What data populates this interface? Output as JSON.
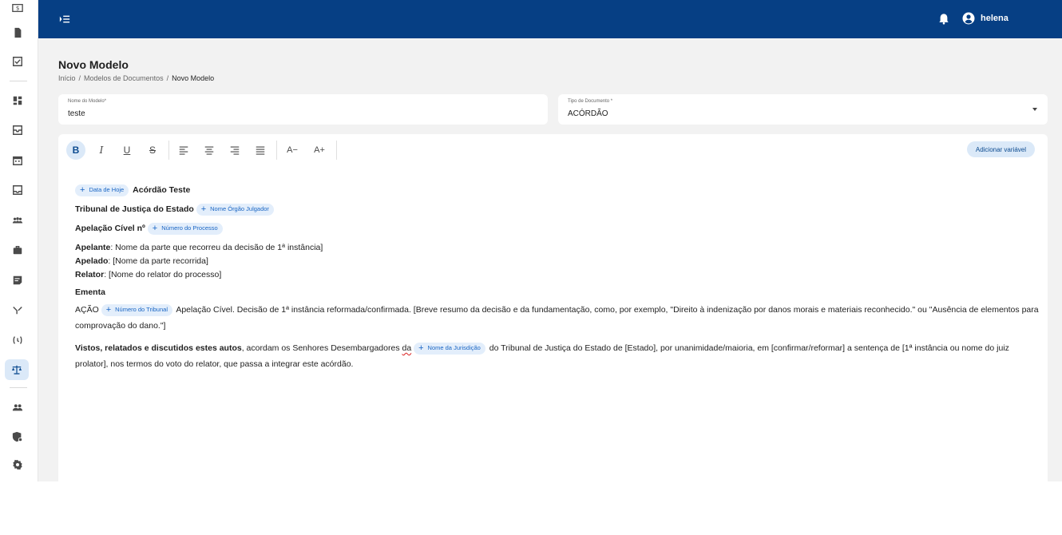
{
  "topbar": {
    "username": "helena"
  },
  "page": {
    "title": "Novo Modelo",
    "breadcrumb": [
      "Início",
      "/",
      "Modelos de Documentos",
      "/",
      "Novo Modelo"
    ]
  },
  "form": {
    "nome_label": "Nome do Modelo*",
    "nome_value": "teste",
    "tipo_label": "Tipo de Documento *",
    "tipo_value": "ACÓRDÃO"
  },
  "toolbar": {
    "bold": "B",
    "italic": "I",
    "underline": "U",
    "strike": "S",
    "font_decrease": "A−",
    "font_increase": "A+",
    "add_variable": "Adicionar variável"
  },
  "document": {
    "line1_title": "Acórdão Teste",
    "line2_text": "Tribunal de Justiça do Estado",
    "line3_text": "Apelação Cível nº",
    "apelante_label": "Apelante",
    "apelante_text": ": Nome da parte que recorreu da decisão de 1ª instância]",
    "apelado_label": "Apelado",
    "apelado_text": ": [Nome da parte recorrida]",
    "relator_label": "Relator",
    "relator_text": ": [Nome do relator do processo]",
    "ementa_title": "Ementa",
    "acao_prefix": "AÇÃO",
    "acao_text": " Apelação Cível. Decisão de 1ª instância reformada/confirmada. [Breve resumo da decisão e da fundamentação, como, por exemplo, \"Direito à indenização por danos morais e materiais reconhecido.\" ou \"Ausência de elementos para comprovação do dano.\"]",
    "vistos_bold": "Vistos, relatados e discutidos estes autos",
    "vistos_text1": ", acordam os Senhores Desembargadores ",
    "vistos_da": "da",
    "vistos_text2": " do Tribunal de Justiça do Estado de [Estado], por unanimidade/maioria, em [confirmar/reformar] a sentença de [1ª instância ou nome do juiz prolator], nos termos do voto do relator, que passa a integrar este acórdão."
  },
  "variables": {
    "data_hoje": "Data de Hoje",
    "orgao_julgador": "Nome Órgão Julgador",
    "numero_processo": "Número do Processo",
    "numero_tribunal": "Número do Tribunal",
    "nome_jurisdicao": "Nome da Jurisdição"
  },
  "colors": {
    "topbar": "#063f84",
    "chip_bg": "#e3eefb",
    "chip_text": "#1a66c4"
  },
  "sidebar_icons": [
    "dollar-icon",
    "document-icon",
    "checklist-icon",
    "dashboard-icon",
    "inbox-icon",
    "calendar-icon",
    "tray-icon",
    "groups-icon",
    "briefcase-icon",
    "notes-icon",
    "merge-icon",
    "sync-icon",
    "scales-icon",
    "people-icon",
    "shield-user-icon",
    "gear-icon"
  ]
}
